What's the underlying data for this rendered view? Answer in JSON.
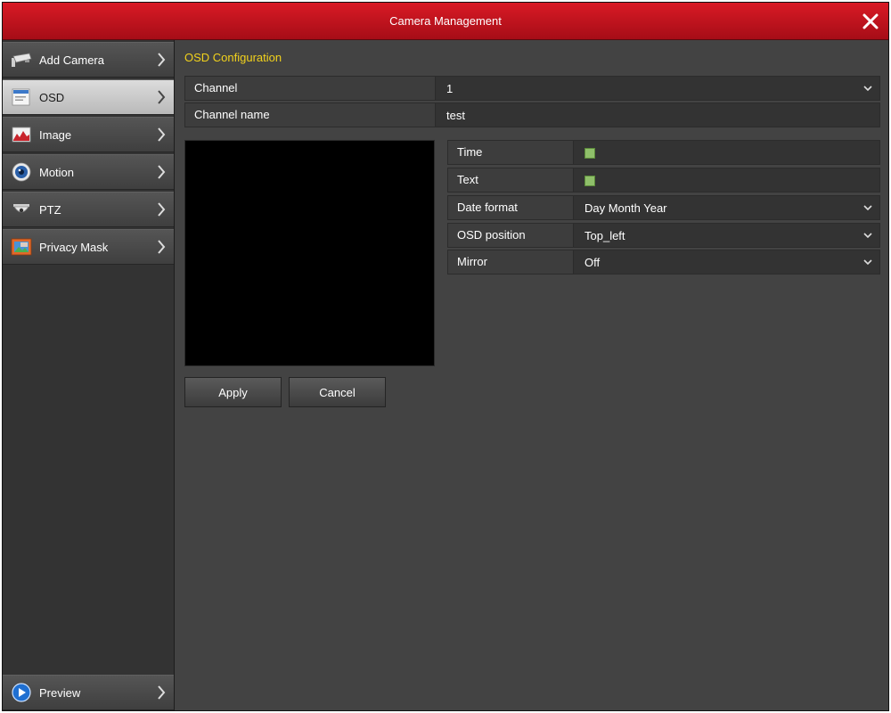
{
  "window": {
    "title": "Camera Management"
  },
  "sidebar": {
    "items": [
      {
        "label": "Add Camera",
        "icon": "camera-icon"
      },
      {
        "label": "OSD",
        "icon": "osd-icon",
        "active": true
      },
      {
        "label": "Image",
        "icon": "image-icon"
      },
      {
        "label": "Motion",
        "icon": "motion-icon"
      },
      {
        "label": "PTZ",
        "icon": "ptz-icon"
      },
      {
        "label": "Privacy Mask",
        "icon": "privacy-mask-icon"
      }
    ],
    "footer": {
      "label": "Preview",
      "icon": "play-icon"
    }
  },
  "main": {
    "section_title": "OSD Configuration",
    "channel": {
      "label": "Channel",
      "value": "1"
    },
    "channel_name": {
      "label": "Channel name",
      "value": "test"
    },
    "settings": {
      "time": {
        "label": "Time",
        "checked": true
      },
      "text": {
        "label": "Text",
        "checked": true
      },
      "date_format": {
        "label": "Date format",
        "value": "Day Month Year"
      },
      "osd_position": {
        "label": "OSD position",
        "value": "Top_left"
      },
      "mirror": {
        "label": "Mirror",
        "value": "Off"
      }
    },
    "buttons": {
      "apply": "Apply",
      "cancel": "Cancel"
    }
  },
  "colors": {
    "title_bar": "#c4141f",
    "section_title": "#f2d21c",
    "checkbox": "#8fbf6a"
  }
}
